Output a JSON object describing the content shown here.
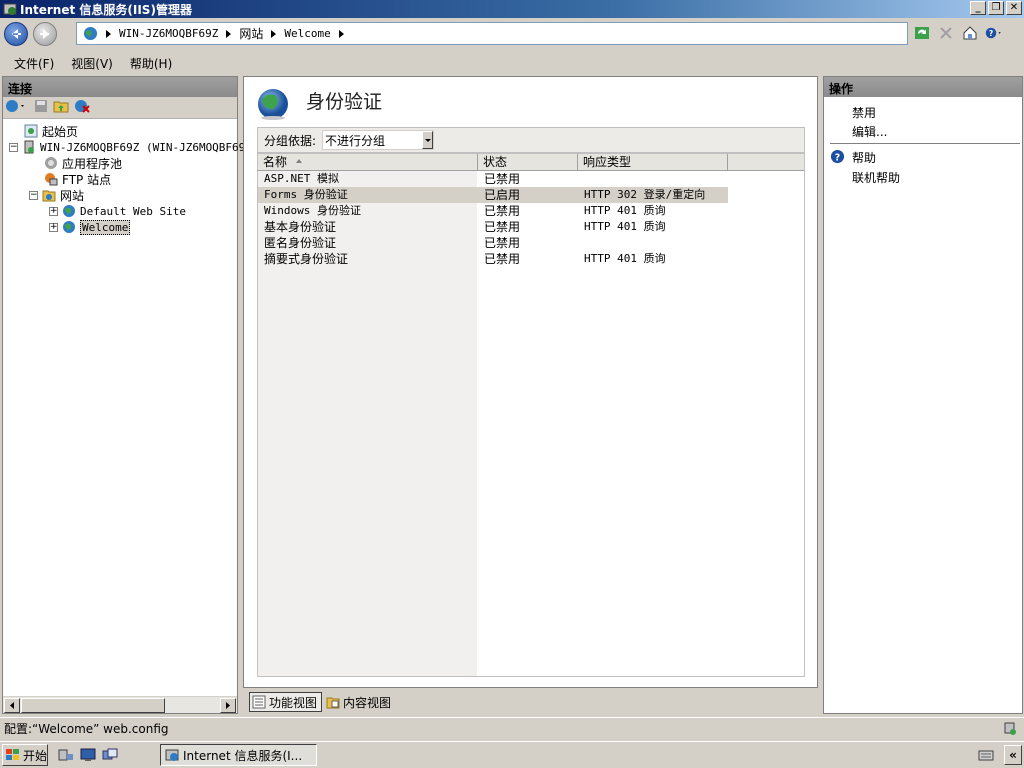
{
  "window": {
    "title": "Internet 信息服务(IIS)管理器"
  },
  "address": {
    "crumbs": [
      "WIN-JZ6MOQBF69Z",
      "网站",
      "Welcome"
    ]
  },
  "menu": {
    "file": "文件(F)",
    "view": "视图(V)",
    "help": "帮助(H)"
  },
  "connections": {
    "header": "连接",
    "tree": {
      "start_page": "起始页",
      "server": "WIN-JZ6MOQBF69Z (WIN-JZ6MOQBF69Z",
      "app_pools": "应用程序池",
      "ftp_sites": "FTP 站点",
      "sites": "网站",
      "default_site": "Default Web Site",
      "welcome": "Welcome"
    }
  },
  "main": {
    "title": "身份验证",
    "group_by_label": "分组依据:",
    "group_by_value": "不进行分组",
    "columns": {
      "name": "名称",
      "status": "状态",
      "response": "响应类型"
    },
    "rows": [
      {
        "name": "ASP.NET 模拟",
        "status": "已禁用",
        "response": ""
      },
      {
        "name": "Forms 身份验证",
        "status": "已启用",
        "response": "HTTP 302 登录/重定向"
      },
      {
        "name": "Windows 身份验证",
        "status": "已禁用",
        "response": "HTTP 401 质询"
      },
      {
        "name": "基本身份验证",
        "status": "已禁用",
        "response": "HTTP 401 质询"
      },
      {
        "name": "匿名身份验证",
        "status": "已禁用",
        "response": ""
      },
      {
        "name": "摘要式身份验证",
        "status": "已禁用",
        "response": "HTTP 401 质询"
      }
    ],
    "tabs": {
      "features": "功能视图",
      "content": "内容视图"
    }
  },
  "actions": {
    "header": "操作",
    "disable": "禁用",
    "edit": "编辑...",
    "help": "帮助",
    "online_help": "联机帮助"
  },
  "status": {
    "text": "配置:“Welcome” web.config"
  },
  "taskbar": {
    "start": "开始",
    "task": "Internet 信息服务(I..."
  },
  "colors": {
    "titlebar": "#0a246a",
    "selection": "#d4d0c8",
    "help_icon": "#1f4fa4"
  }
}
